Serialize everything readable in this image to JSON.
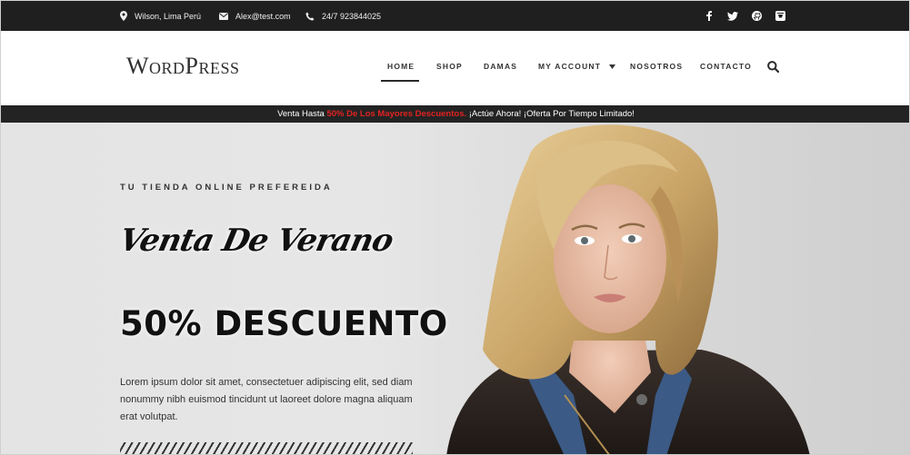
{
  "topbar": {
    "location": "Wilson, Lima Perú",
    "email": "Alex@test.com",
    "phone": "24/7 923844025",
    "icons": [
      "map-marker-icon",
      "envelope-icon",
      "phone-icon"
    ],
    "social": [
      "facebook-icon",
      "twitter-icon",
      "github-icon",
      "bandcamp-icon"
    ]
  },
  "header": {
    "logo_text": "WordPress",
    "nav": [
      {
        "label": "HOME",
        "active": true
      },
      {
        "label": "SHOP"
      },
      {
        "label": "DAMAS"
      },
      {
        "label": "MY ACCOUNT",
        "dropdown": true
      },
      {
        "label": "NOSOTROS"
      },
      {
        "label": "CONTACTO"
      }
    ],
    "search_icon": "search-icon"
  },
  "promo": {
    "prefix": "Venta Hasta ",
    "highlight": "50% De Los Mayores Descuentos.",
    "suffix": " ¡Actúe Ahora! ¡Oferta Por Tiempo Limitado!",
    "highlight_color": "#e32222"
  },
  "hero": {
    "eyebrow": "TU TIENDA ONLINE PREFEREIDA",
    "script_title": "Venta De Verano",
    "headline": "50% DESCUENTO",
    "description": "Lorem ipsum dolor sit amet, consectetuer adipiscing elit, sed diam nonummy nibh euismod tincidunt ut laoreet dolore magna aliquam erat volutpat."
  },
  "colors": {
    "topbar_bg": "#1f1f1f",
    "accent_red": "#e32222",
    "hero_bg": "#e4e4e4"
  }
}
